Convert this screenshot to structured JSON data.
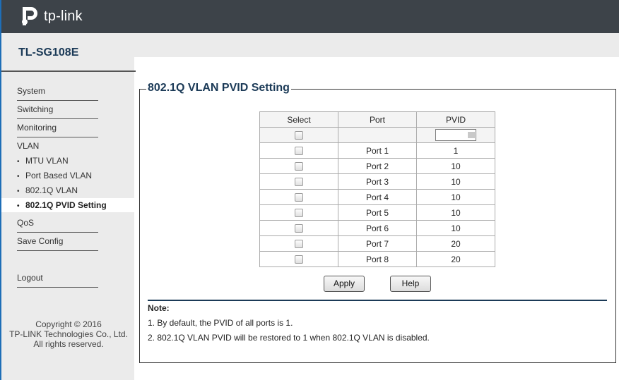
{
  "header": {
    "brand": "tp-link"
  },
  "sidebar": {
    "model": "TL-SG108E",
    "menu": [
      {
        "label": "System"
      },
      {
        "label": "Switching"
      },
      {
        "label": "Monitoring"
      },
      {
        "label": "VLAN"
      }
    ],
    "vlan_sub": [
      {
        "label": "MTU VLAN"
      },
      {
        "label": "Port Based VLAN"
      },
      {
        "label": "802.1Q VLAN"
      },
      {
        "label": "802.1Q PVID Setting"
      }
    ],
    "menu2": [
      {
        "label": "QoS"
      },
      {
        "label": "Save Config"
      }
    ],
    "logout": "Logout",
    "copyright": [
      "Copyright © 2016",
      "TP-LINK Technologies Co., Ltd.",
      "All rights reserved."
    ]
  },
  "main": {
    "title": "802.1Q VLAN PVID Setting",
    "table": {
      "headers": [
        "Select",
        "Port",
        "PVID"
      ],
      "rows": [
        {
          "port": "Port 1",
          "pvid": "1"
        },
        {
          "port": "Port 2",
          "pvid": "10"
        },
        {
          "port": "Port 3",
          "pvid": "10"
        },
        {
          "port": "Port 4",
          "pvid": "10"
        },
        {
          "port": "Port 5",
          "pvid": "10"
        },
        {
          "port": "Port 6",
          "pvid": "10"
        },
        {
          "port": "Port 7",
          "pvid": "20"
        },
        {
          "port": "Port 8",
          "pvid": "20"
        }
      ]
    },
    "buttons": {
      "apply": "Apply",
      "help": "Help"
    },
    "note": {
      "title": "Note:",
      "lines": [
        "1. By default, the PVID of all ports is 1.",
        "2. 802.1Q VLAN PVID will be restored to 1 when 802.1Q VLAN is disabled."
      ]
    }
  }
}
